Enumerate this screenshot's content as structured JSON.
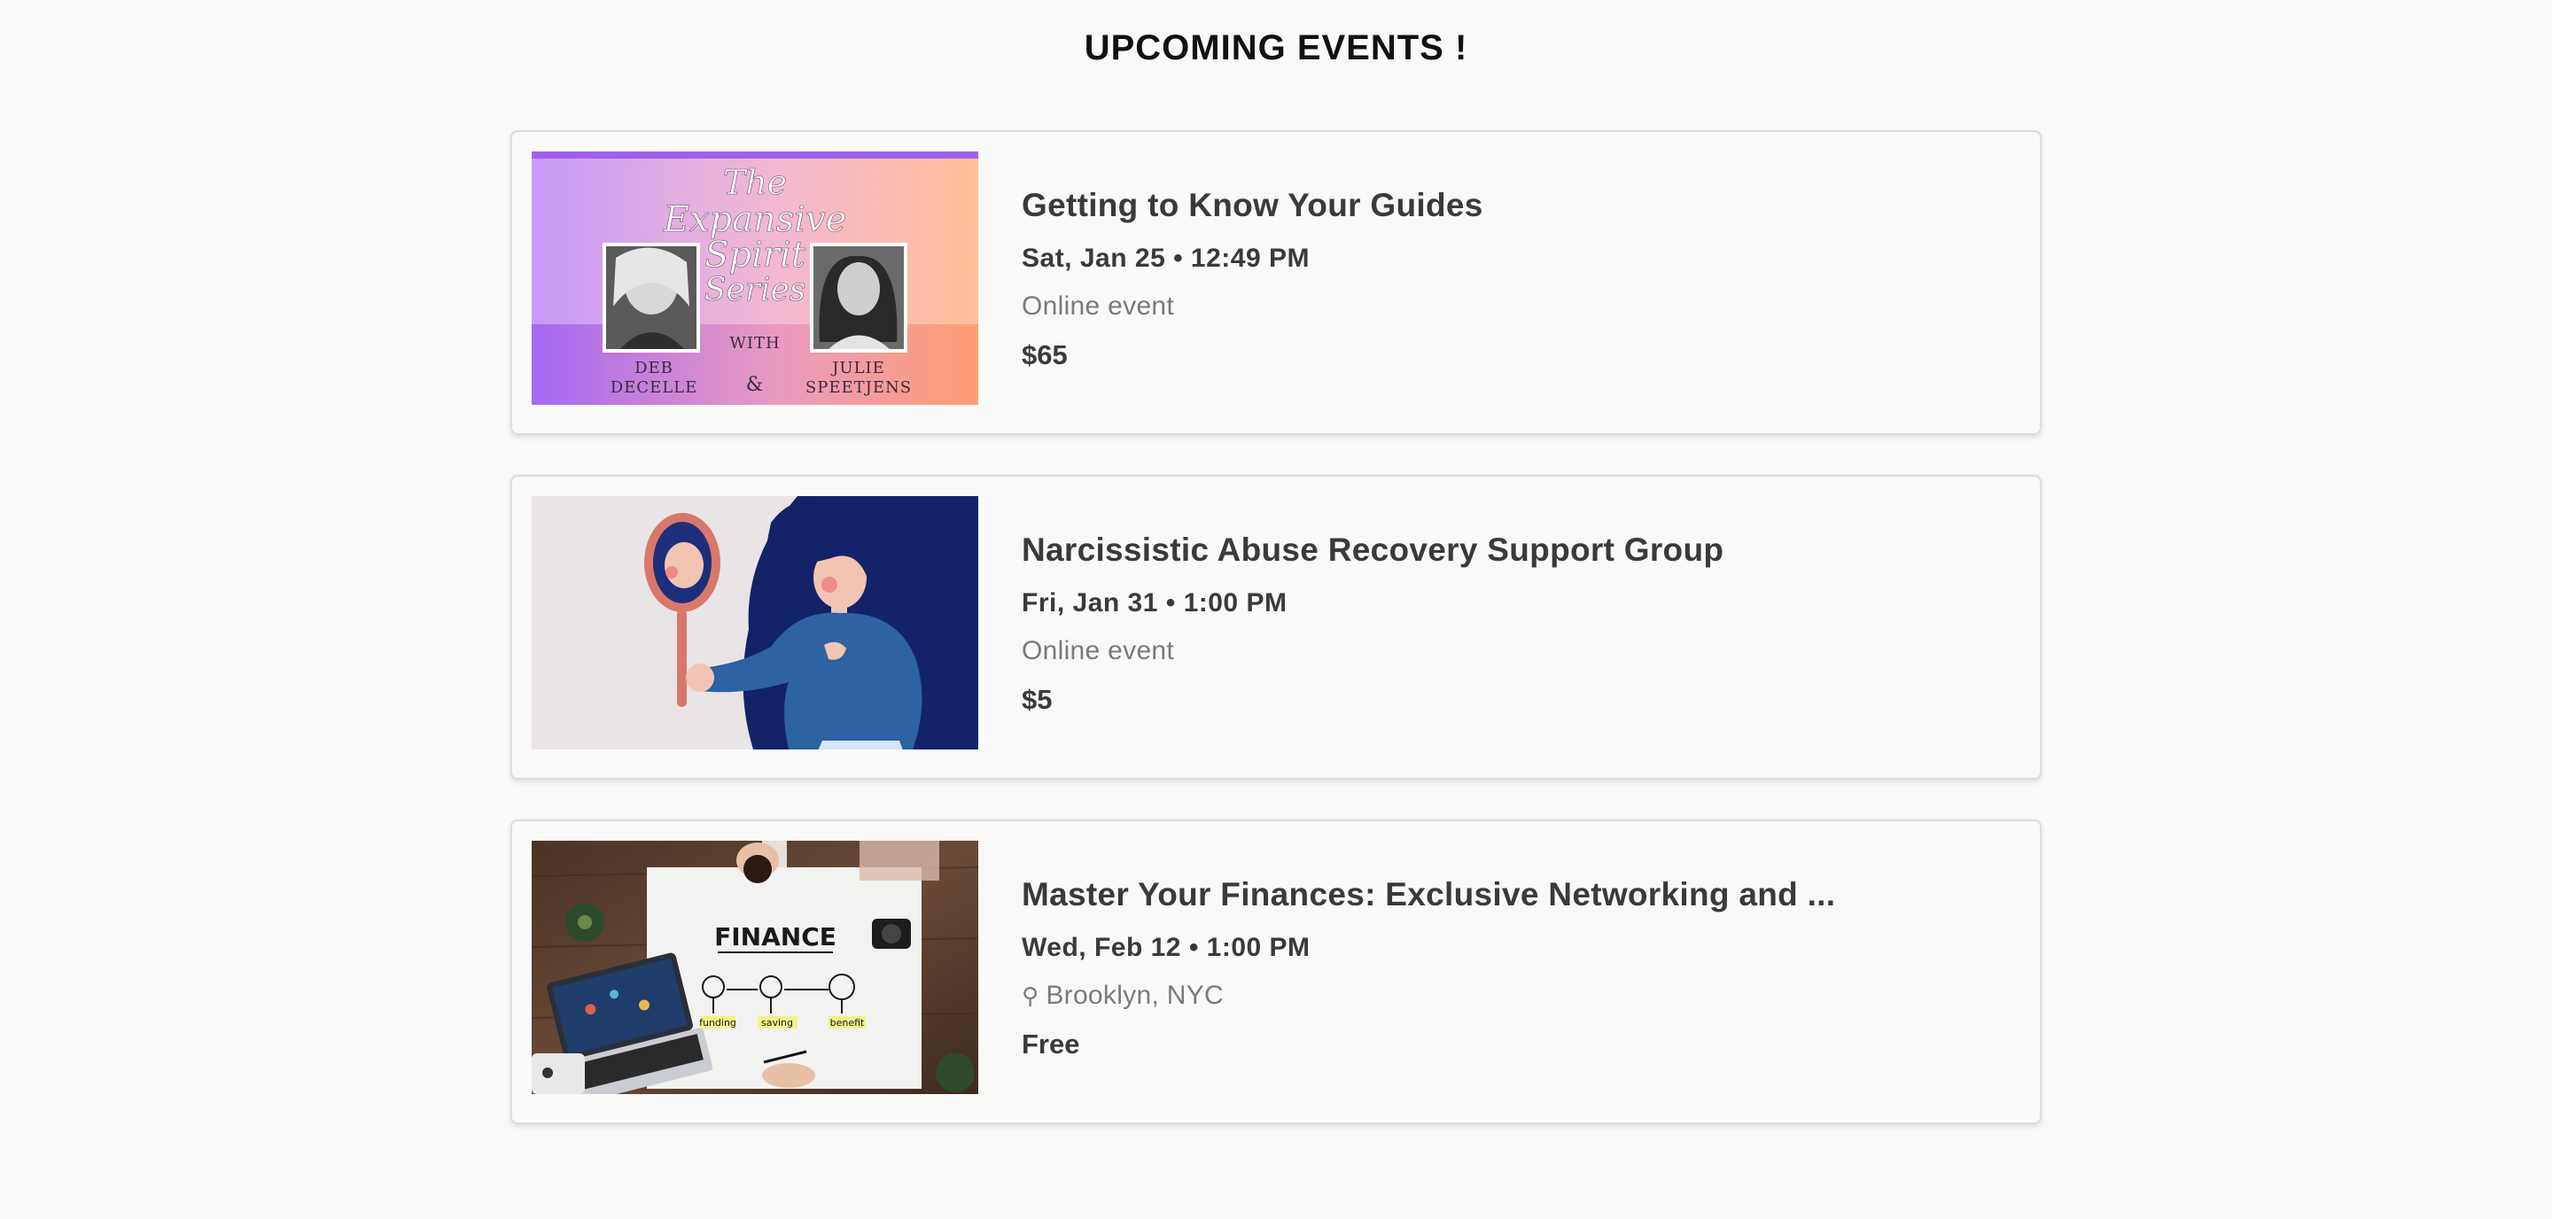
{
  "page": {
    "title": "UPCOMING EVENTS !"
  },
  "events": [
    {
      "title": "Getting to Know Your Guides",
      "date": "Sat, Jan 25 • 12:49 PM",
      "location": "Online event",
      "price": "$65",
      "image": {
        "icon": "event-banner-image",
        "text_lines": [
          "The",
          "Expansive",
          "Spirit",
          "Series"
        ],
        "with": "WITH",
        "amp": "&",
        "left_name": [
          "DEB",
          "DECELLE"
        ],
        "right_name": [
          "JULIE",
          "SPEETJENS"
        ]
      }
    },
    {
      "title": "Narcissistic Abuse Recovery Support Group",
      "date": "Fri, Jan 31 • 1:00 PM",
      "location": "Online event",
      "price": "$5",
      "image": {
        "icon": "woman-mirror-illustration"
      }
    },
    {
      "title": "Master Your Finances: Exclusive Networking and ...",
      "date": "Wed, Feb 12 • 1:00 PM",
      "location": "Brooklyn, NYC",
      "location_icon": "map-pin-icon",
      "price": "Free",
      "image": {
        "icon": "finance-desk-photo",
        "heading": "FINANCE",
        "labels": [
          "funding",
          "saving",
          "benefit"
        ]
      }
    }
  ],
  "colors": {
    "background": "#f9f9f8",
    "card_border": "#dcdcdc",
    "text_primary": "#3a3a3a",
    "text_muted": "#7a7a7a"
  }
}
